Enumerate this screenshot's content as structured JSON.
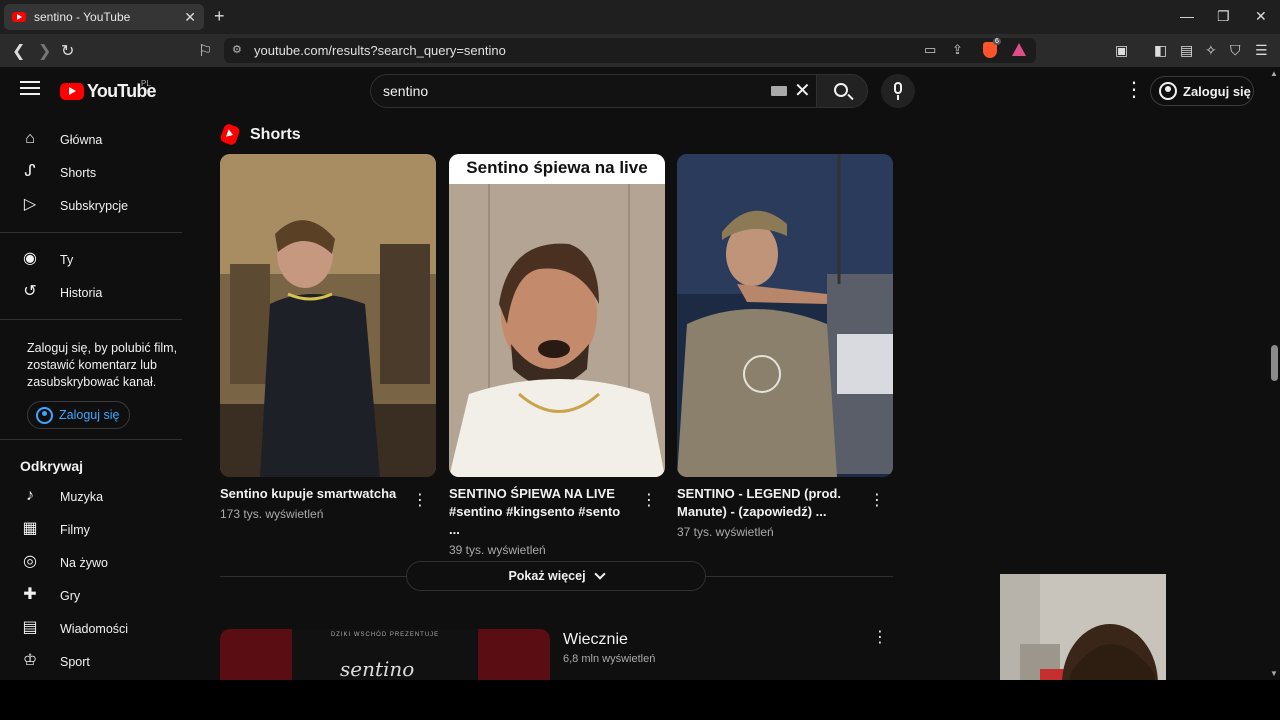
{
  "browser": {
    "tab_title": "sentino - YouTube",
    "url": "youtube.com/results?search_query=sentino",
    "brave_badge": "6"
  },
  "masthead": {
    "logo_text": "YouTube",
    "country_code": "PL",
    "search_value": "sentino",
    "signin_label": "Zaloguj się"
  },
  "sidebar": {
    "main": [
      {
        "label": "Główna",
        "icon": "home-icon"
      },
      {
        "label": "Shorts",
        "icon": "shorts-icon"
      },
      {
        "label": "Subskrypcje",
        "icon": "subscriptions-icon"
      }
    ],
    "you": [
      {
        "label": "Ty",
        "icon": "account-icon"
      },
      {
        "label": "Historia",
        "icon": "history-icon"
      }
    ],
    "signin_message": "Zaloguj się, by polubić film, zostawić komentarz lub zasubskrybować kanał.",
    "signin_button": "Zaloguj się",
    "explore_title": "Odkrywaj",
    "explore": [
      {
        "label": "Muzyka",
        "icon": "music-icon"
      },
      {
        "label": "Filmy",
        "icon": "movies-icon"
      },
      {
        "label": "Na żywo",
        "icon": "live-icon"
      },
      {
        "label": "Gry",
        "icon": "gaming-icon"
      },
      {
        "label": "Wiadomości",
        "icon": "news-icon"
      },
      {
        "label": "Sport",
        "icon": "trophy-icon"
      }
    ]
  },
  "shorts": {
    "heading": "Shorts",
    "items": [
      {
        "title": "Sentino kupuje smartwatcha",
        "views": "173 tys. wyświetleń"
      },
      {
        "title": "SENTINO ŚPIEWA NA LIVE #sentino #kingsento #sento ...",
        "views": "39 tys. wyświetleń",
        "caption": "Sentino śpiewa na live"
      },
      {
        "title": "SENTINO - LEGEND (prod. Manute) - (zapowiedź) ...",
        "views": "37 tys. wyświetleń"
      }
    ],
    "show_more": "Pokaż więcej"
  },
  "video": {
    "title": "Wiecznie",
    "views": "6,8 mln wyświetleń",
    "poster_top": "DZIKI WSCHÓD PREZENTUJE",
    "poster_name": "sentino"
  },
  "colors": {
    "accent": "#ff0000",
    "link": "#3ea6ff",
    "background": "#0f0f0f"
  }
}
